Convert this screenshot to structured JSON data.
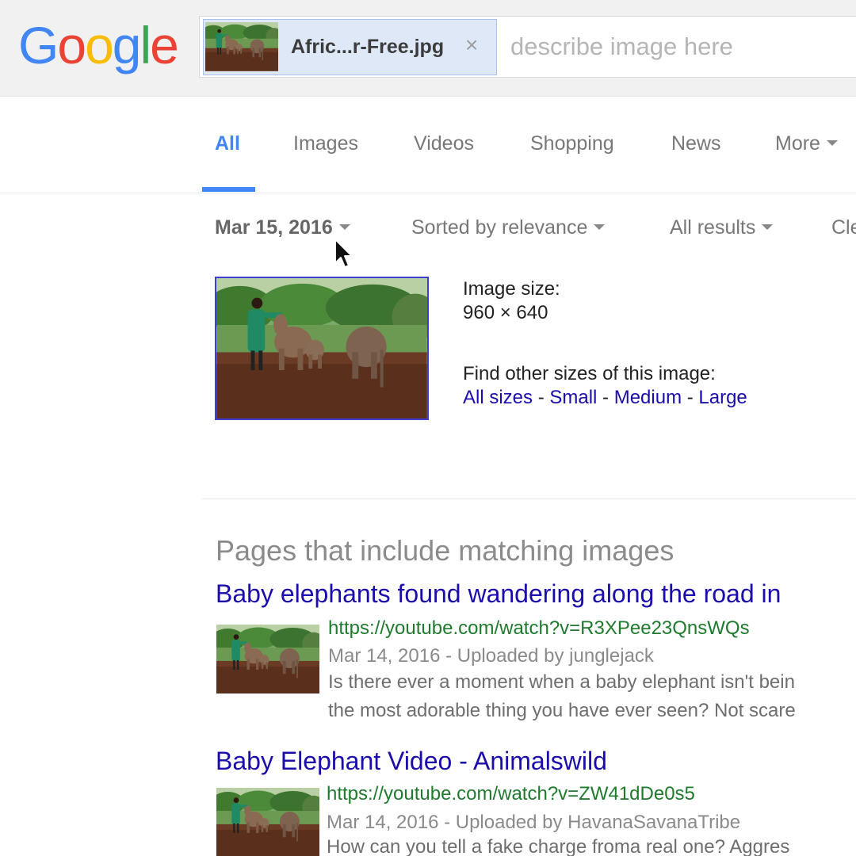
{
  "logo": {
    "text": [
      "G",
      "o",
      "o",
      "g",
      "l",
      "e"
    ],
    "colors": [
      "#4285F4",
      "#EA4335",
      "#FBBC05",
      "#4285F4",
      "#34A853",
      "#EA4335"
    ]
  },
  "search": {
    "chip_filename": "Afric...r-Free.jpg",
    "chip_close": "×",
    "placeholder": "describe image here"
  },
  "tabs": [
    {
      "label": "All",
      "active": true
    },
    {
      "label": "Images"
    },
    {
      "label": "Videos"
    },
    {
      "label": "Shopping"
    },
    {
      "label": "News"
    },
    {
      "label": "More"
    }
  ],
  "filters": {
    "date": "Mar 15, 2016",
    "sort": "Sorted by relevance",
    "results": "All results",
    "clear": "Cle"
  },
  "image_info": {
    "size_label": "Image size:",
    "size_value": "960 × 640",
    "other_sizes_label": "Find other sizes of this image:",
    "links": [
      "All sizes",
      "Small",
      "Medium",
      "Large"
    ],
    "separator": " - "
  },
  "section_title": "Pages that include matching images",
  "results": [
    {
      "title": "Baby elephants found wandering along the road in",
      "url": "https://youtube.com/watch?v=R3XPee23QnsWQs",
      "meta": "Mar 14, 2016 - Uploaded by junglejack",
      "snippet": [
        "Is there ever a moment when a baby elephant isn't bein",
        "the most adorable thing you have ever seen? Not scare"
      ]
    },
    {
      "title": "Baby Elephant Video - Animalswild",
      "url": "https://youtube.com/watch?v=ZW41dDe0s5",
      "meta": "Mar 14, 2016 - Uploaded by HavanaSavanaTribe",
      "snippet": [
        "How can you tell a fake charge froma real one? Aggres"
      ]
    }
  ],
  "colors": {
    "link": "#1a0dab",
    "url": "#1f7a2e",
    "accent": "#4285f4"
  }
}
